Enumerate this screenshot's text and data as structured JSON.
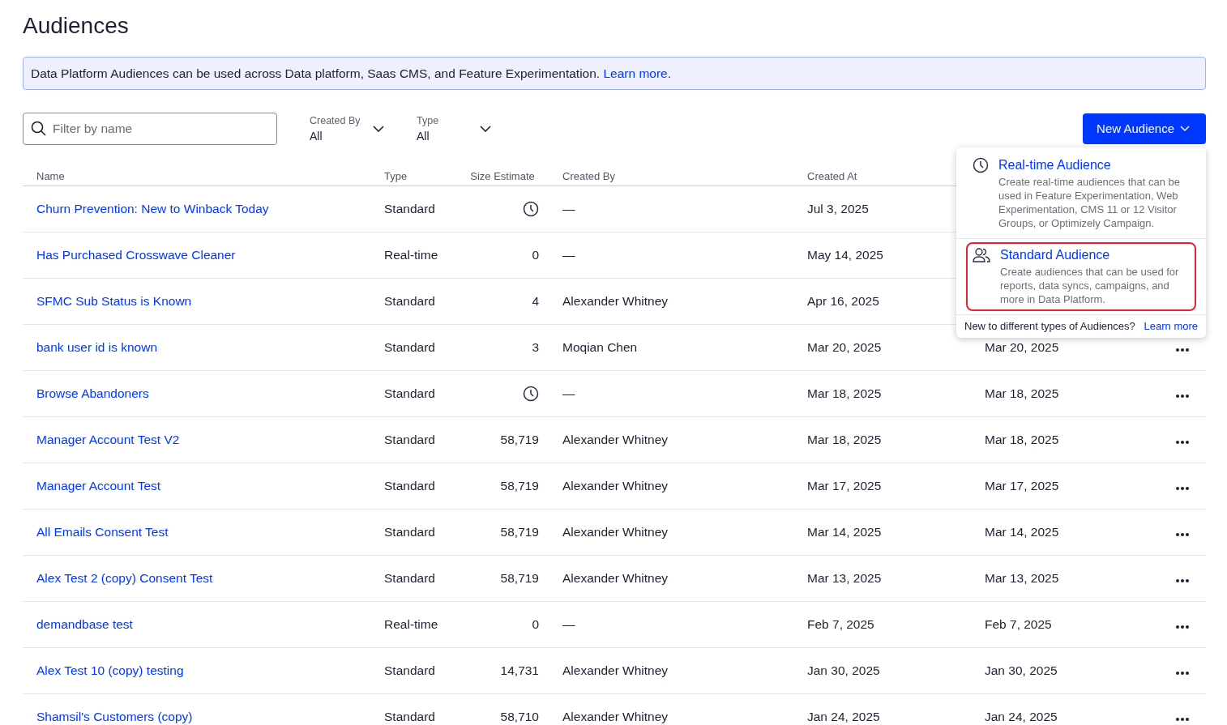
{
  "title": "Audiences",
  "banner": {
    "text": "Data Platform Audiences can be used across Data platform, Saas CMS, and Feature Experimentation.",
    "link": "Learn more",
    "end": "."
  },
  "search": {
    "placeholder": "Filter by name"
  },
  "filters": [
    {
      "label": "Created By",
      "value": "All"
    },
    {
      "label": "Type",
      "value": "All"
    }
  ],
  "new_button": "New Audience",
  "menu": {
    "items": [
      {
        "kind": "realtime",
        "title": "Real-time Audience",
        "description": "Create real-time audiences that can be used in Feature Experimentation, Web Experimentation, CMS 11 or 12 Visitor Groups, or Optimizely Campaign.",
        "selected": false
      },
      {
        "kind": "standard",
        "title": "Standard Audience",
        "description": "Create audiences that can be used for reports, data syncs, campaigns, and more in Data Platform.",
        "selected": true
      }
    ],
    "footer": "New to different types of Audiences?",
    "footer_link": "Learn more"
  },
  "table": {
    "columns": [
      "Name",
      "Type",
      "Size Estimate",
      "Created By",
      "Created At"
    ],
    "rows": [
      {
        "name": "Churn Prevention: New to Winback Today",
        "type": "Standard",
        "size_pending": true,
        "created_by": "—",
        "created_at": "Jul 3, 2025"
      },
      {
        "name": "Has Purchased Crosswave Cleaner",
        "type": "Real-time",
        "size": "0",
        "size_pending": false,
        "created_by": "—",
        "created_at": "May 14, 2025"
      },
      {
        "name": "SFMC Sub Status is Known",
        "type": "Standard",
        "size": "4",
        "size_pending": false,
        "created_by": "Alexander Whitney",
        "created_at": "Apr 16, 2025"
      },
      {
        "name": "bank user id is known",
        "type": "Standard",
        "size": "3",
        "size_pending": false,
        "created_by": "Moqian Chen",
        "created_at": "Mar 20, 2025",
        "updated_at": "Mar 20, 2025"
      },
      {
        "name": "Browse Abandoners",
        "type": "Standard",
        "size_pending": true,
        "created_by": "—",
        "created_at": "Mar 18, 2025",
        "updated_at": "Mar 18, 2025"
      },
      {
        "name": "Manager Account Test V2",
        "type": "Standard",
        "size": "58,719",
        "size_pending": false,
        "created_by": "Alexander Whitney",
        "created_at": "Mar 18, 2025",
        "updated_at": "Mar 18, 2025"
      },
      {
        "name": "Manager Account Test",
        "type": "Standard",
        "size": "58,719",
        "size_pending": false,
        "created_by": "Alexander Whitney",
        "created_at": "Mar 17, 2025",
        "updated_at": "Mar 17, 2025"
      },
      {
        "name": "All Emails Consent Test",
        "type": "Standard",
        "size": "58,719",
        "size_pending": false,
        "created_by": "Alexander Whitney",
        "created_at": "Mar 14, 2025",
        "updated_at": "Mar 14, 2025"
      },
      {
        "name": "Alex Test 2 (copy) Consent Test",
        "type": "Standard",
        "size": "58,719",
        "size_pending": false,
        "created_by": "Alexander Whitney",
        "created_at": "Mar 13, 2025",
        "updated_at": "Mar 13, 2025"
      },
      {
        "name": "demandbase test",
        "type": "Real-time",
        "size": "0",
        "size_pending": false,
        "created_by": "—",
        "created_at": "Feb 7, 2025",
        "updated_at": "Feb 7, 2025"
      },
      {
        "name": "Alex Test 10 (copy) testing",
        "type": "Standard",
        "size": "14,731",
        "size_pending": false,
        "created_by": "Alexander Whitney",
        "created_at": "Jan 30, 2025",
        "updated_at": "Jan 30, 2025"
      },
      {
        "name": "Shamsil's Customers (copy)",
        "type": "Standard",
        "size": "58,710",
        "size_pending": false,
        "created_by": "Alexander Whitney",
        "created_at": "Jan 24, 2025",
        "updated_at": "Jan 24, 2025"
      }
    ]
  }
}
